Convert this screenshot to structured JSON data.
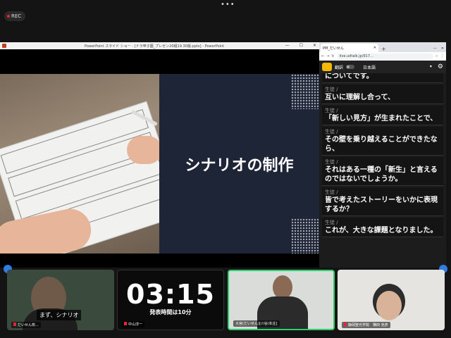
{
  "top": {
    "rec_label": "REC"
  },
  "ppt": {
    "title": "PowerPoint スライド ショー - [ドラ甲子園_プレゼン20組19.30版.pptx] - PowerPoint",
    "slide_title": "シナリオの制作"
  },
  "browser": {
    "tab_title": "PM_だいせん",
    "url": "live.udtalk.jp/917...",
    "translate_label": "翻訳",
    "language": "日本語"
  },
  "chat": {
    "messages": [
      {
        "speaker": "",
        "text": "についてです。"
      },
      {
        "speaker": "生徒 /",
        "text": "互いに理解し合って、"
      },
      {
        "speaker": "生徒 /",
        "text": "「新しい見方」が生まれたことで、"
      },
      {
        "speaker": "生徒 /",
        "text": "その壁を乗り越えることができたなら、"
      },
      {
        "speaker": "生徒 /",
        "text": "それはある一種の「新生」と言えるのではないでしょうか。"
      },
      {
        "speaker": "生徒 /",
        "text": "皆で考えたストーリーをいかに表現するか？"
      },
      {
        "speaker": "生徒 /",
        "text": "これが、大きな課題となりました。"
      }
    ]
  },
  "gallery": {
    "tile1": {
      "name": "だいせん校...",
      "caption": "まず、シナリオ"
    },
    "tile2": {
      "name": "中山淳一",
      "timer": "03:15",
      "timer_note": "発表時間は10分"
    },
    "tile3": {
      "name": "大宮(だいせん)[川谷/本庄]"
    },
    "tile4": {
      "name": "静岡聖光学院　横田 克彦"
    }
  }
}
